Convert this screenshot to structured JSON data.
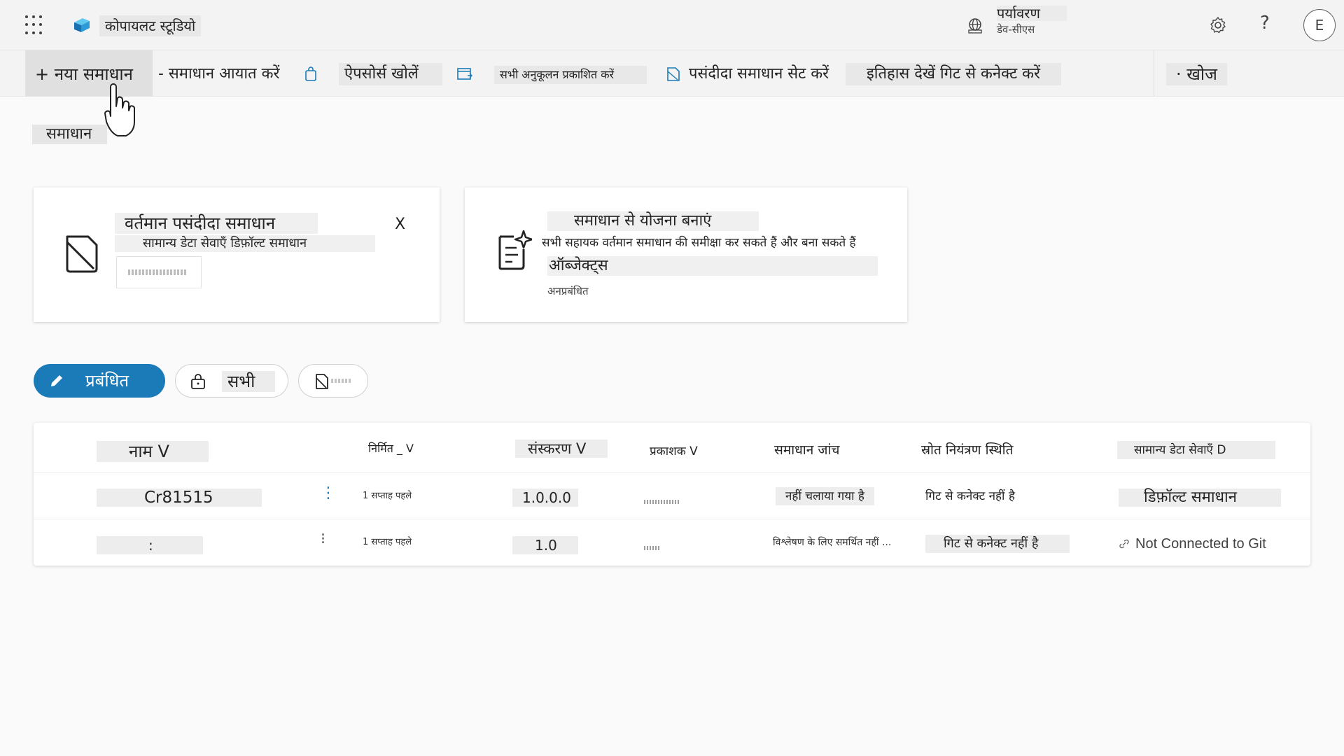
{
  "header": {
    "app_title": "कोपायलट स्टूडियो",
    "environment_label": "पर्यावरण",
    "environment_name": "डेव-सीएस",
    "help_glyph": "?",
    "avatar_initial": "E"
  },
  "command_bar": {
    "new_solution": "+ नया समाधान",
    "import_solution": "- समाधान आयात करें",
    "open_appsource": "ऐपसोर्स खोलें",
    "publish_all": "सभी अनुकूलन प्रकाशित करें",
    "set_preferred": "पसंदीदा समाधान सेट करें",
    "history_git": "इतिहास देखें गिट से कनेक्ट करें",
    "search": "· खोज"
  },
  "page": {
    "section_title": "समाधान"
  },
  "cards": {
    "preferred": {
      "title": "वर्तमान पसंदीदा समाधान",
      "subtitle": "सामान्य डेटा सेवाएँ डिफ़ॉल्ट समाधान",
      "close": "X"
    },
    "plan": {
      "title": "समाधान से योजना बनाएं",
      "description": "सभी सहायक वर्तमान समाधान की समीक्षा कर सकते हैं और बना सकते हैं",
      "objects": "ऑब्जेक्ट्स",
      "status": "अनप्रबंधित"
    }
  },
  "filters": {
    "managed": "प्रबंधित",
    "all": "सभी"
  },
  "table": {
    "headers": {
      "name": "नाम V",
      "created": "निर्मित _ V",
      "version": "संस्करण V",
      "publisher": "प्रकाशक V",
      "check": "समाधान जांच",
      "source_control": "स्रोत नियंत्रण स्थिति",
      "cds": "सामान्य डेटा सेवाएँ D"
    },
    "rows": [
      {
        "name": "Cr81515",
        "dots": "⋮",
        "created": "1 सप्ताह पहले",
        "version": "1.0.0.0",
        "check": "नहीं चलाया गया है",
        "source_control": "गिट से कनेक्ट नहीं है",
        "cds": "डिफ़ॉल्ट समाधान"
      },
      {
        "name": ":",
        "dots": "⁝",
        "created": "1 सप्ताह पहले",
        "version": "1.0",
        "check": "विश्लेषण के लिए समर्थित नहीं ...",
        "source_control": "गिट से कनेक्ट नहीं है",
        "cds": "Not Connected to Git"
      }
    ]
  },
  "icons": {
    "waffle": "waffle-icon",
    "logo": "copilot-studio-logo",
    "environment": "globe-icon",
    "settings": "gear-icon",
    "help": "help-icon",
    "cursor": "hand-pointer-cursor",
    "link": "link-icon"
  },
  "colors": {
    "accent": "#1b7bb8",
    "header_bg": "#f3f3f3",
    "page_bg": "#fafafa"
  }
}
